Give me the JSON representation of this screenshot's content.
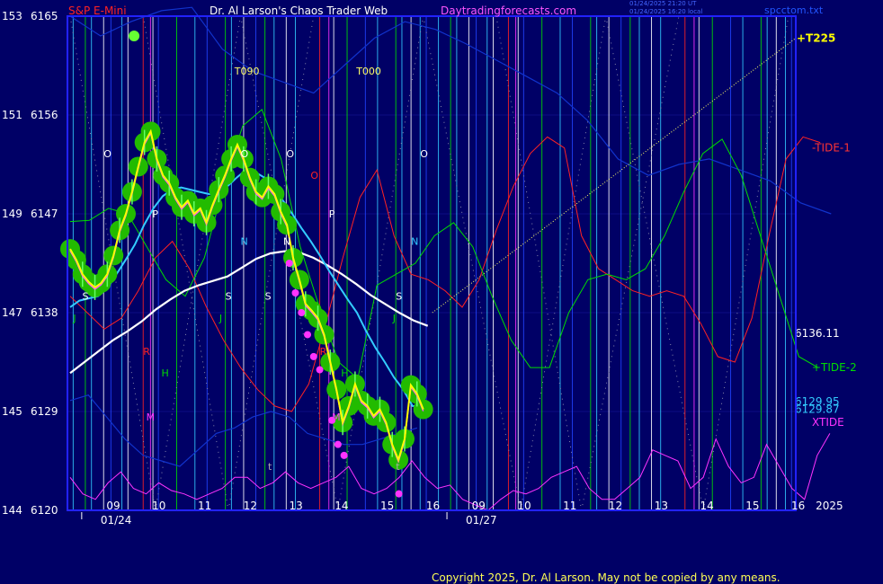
{
  "header": {
    "instrument": "S&P E-Mini",
    "author": "Dr. Al Larson's Chaos Trader Web",
    "site": "Daytradingforecasts.com",
    "timestamp_1": "01/24/2025 21:20 UT",
    "timestamp_2": "01/24/2025 16:20 local",
    "file": "spcctom.txt"
  },
  "footer": {
    "copyright": "Copyright 2025, Dr. Al Larson. May not be copied by any means."
  },
  "colors": {
    "background": "#000066",
    "plot_border": "#2222ff",
    "price_bead": "#22bb00",
    "price_line": "#ffff00",
    "tide1": "#ff2222",
    "tide2": "#00dd00",
    "xtide": "#ff33ff",
    "avg_fast": "#33ccff",
    "avg_slow": "#ffffff",
    "blue_band": "#1133cc",
    "trend": "#ffff66"
  },
  "chart_data": {
    "type": "line",
    "x_ticks": [
      {
        "label": "09",
        "i": 7
      },
      {
        "label": "10",
        "i": 14.5
      },
      {
        "label": "11",
        "i": 22
      },
      {
        "label": "12",
        "i": 29.5
      },
      {
        "label": "13",
        "i": 37
      },
      {
        "label": "14",
        "i": 44.5
      },
      {
        "label": "15",
        "i": 52
      },
      {
        "label": "16",
        "i": 59.5
      },
      {
        "label": "09",
        "i": 67
      },
      {
        "label": "10",
        "i": 74.5
      },
      {
        "label": "11",
        "i": 82
      },
      {
        "label": "12",
        "i": 89.5
      },
      {
        "label": "13",
        "i": 97
      },
      {
        "label": "14",
        "i": 104.5
      },
      {
        "label": "15",
        "i": 112
      },
      {
        "label": "16",
        "i": 119.5
      },
      {
        "label": "2025",
        "i": 123.5
      }
    ],
    "date_labels": [
      {
        "label": "01/24",
        "i": 5
      },
      {
        "label": "01/27",
        "i": 65
      }
    ],
    "y_ticks": [
      {
        "left": "153",
        "value": 6165
      },
      {
        "left": "151",
        "value": 6156
      },
      {
        "left": "149",
        "value": 6147
      },
      {
        "left": "147",
        "value": 6138
      },
      {
        "left": "145",
        "value": 6129
      },
      {
        "left": "144",
        "value": 6120
      }
    ],
    "ylim": [
      6120,
      6165
    ],
    "x_range": [
      0,
      120
    ],
    "series": [
      {
        "key": "price",
        "values": [
          6143.8,
          6142.8,
          6141.5,
          6140.8,
          6140.3,
          6140.7,
          6141.5,
          6143.2,
          6145.5,
          6147.0,
          6149.0,
          6151.3,
          6153.5,
          6154.5,
          6152.0,
          6150.5,
          6149.8,
          6148.5,
          6147.6,
          6148.2,
          6147.0,
          6147.5,
          6146.2,
          6147.8,
          6149.2,
          6150.5,
          6152.0,
          6153.3,
          6152.0,
          6150.3,
          6149.0,
          6148.5,
          6149.5,
          6148.8,
          6147.2,
          6146.0,
          6143.0,
          6141.0,
          6138.8,
          6138.2,
          6137.5,
          6136.0,
          6133.5,
          6131.0,
          6128.0,
          6129.5,
          6131.5,
          6130.0,
          6129.5,
          6128.6,
          6129.2,
          6128.0,
          6126.0,
          6124.6,
          6126.5,
          6131.4,
          6130.6,
          6129.2
        ]
      },
      {
        "key": "avg_fast",
        "values": [
          6138.5,
          6139.1,
          6139.3,
          6139.5,
          6140.2,
          6141.5,
          6142.8,
          6144.2,
          6146.0,
          6147.5,
          6148.6,
          6149.2,
          6149.4,
          6149.2,
          6149.0,
          6148.8,
          6148.9,
          6149.5,
          6150.3,
          6151.0,
          6150.8,
          6150.3,
          6149.5,
          6148.2,
          6147.0,
          6145.7,
          6144.5,
          6143.2,
          6141.8,
          6140.5,
          6139.2,
          6138.0,
          6136.3,
          6134.8,
          6133.5,
          6132.1,
          6131.0,
          6129.5,
          6129.5
        ]
      },
      {
        "key": "avg_slow",
        "values": [
          6132.5,
          6133.5,
          6134.5,
          6135.5,
          6136.3,
          6137.2,
          6138.3,
          6139.2,
          6140.0,
          6140.5,
          6140.9,
          6141.3,
          6142.1,
          6142.9,
          6143.4,
          6143.6,
          6143.5,
          6143.0,
          6142.3,
          6141.5,
          6140.6,
          6139.6,
          6138.8,
          6138.0,
          6137.3,
          6136.8
        ]
      },
      {
        "key": "tide1",
        "values": [
          6139.5,
          6138.0,
          6136.5,
          6137.5,
          6140.0,
          6143.0,
          6144.5,
          6142.0,
          6138.5,
          6135.5,
          6133.0,
          6131.0,
          6129.5,
          6129.0,
          6131.5,
          6137.0,
          6143.0,
          6148.5,
          6151.0,
          6145.0,
          6141.5,
          6141.0,
          6140.0,
          6138.5,
          6141.0,
          6145.5,
          6149.5,
          6152.5,
          6154.0,
          6153.0,
          6145.0,
          6142.0,
          6141.0,
          6140.0,
          6139.5,
          6140.0,
          6139.5,
          6137.0,
          6134.0,
          6133.5,
          6137.5,
          6145.0,
          6152.0,
          6154.0,
          6153.5
        ]
      },
      {
        "key": "tide2",
        "values": [
          6146.3,
          6146.4,
          6147.5,
          6147.0,
          6144.0,
          6141.0,
          6139.5,
          6143.0,
          6149.5,
          6155.0,
          6156.5,
          6152.0,
          6144.0,
          6138.5,
          6133.5,
          6132.0,
          6140.5,
          6141.5,
          6142.5,
          6145.0,
          6146.2,
          6144.0,
          6139.5,
          6135.5,
          6133.0,
          6133.0,
          6138.0,
          6141.0,
          6141.5,
          6141.0,
          6142.0,
          6145.0,
          6149.0,
          6152.5,
          6153.8,
          6150.5,
          6145.0,
          6139.5,
          6134.0,
          6133.0
        ]
      },
      {
        "key": "xtide",
        "values": [
          6123.0,
          6121.5,
          6121.0,
          6122.5,
          6123.5,
          6122.0,
          6121.5,
          6122.5,
          6121.8,
          6121.5,
          6121.0,
          6121.5,
          6122.0,
          6123.0,
          6123.0,
          6122.0,
          6122.5,
          6123.5,
          6122.5,
          6122.0,
          6122.5,
          6123.0,
          6124.0,
          6122.0,
          6121.5,
          6122.0,
          6123.0,
          6124.5,
          6123.0,
          6122.0,
          6122.3,
          6121.0,
          6120.5,
          6120.0,
          6121.0,
          6121.8,
          6121.5,
          6122.0,
          6123.0,
          6123.5,
          6124.0,
          6122.0,
          6121.0,
          6121.0,
          6122.0,
          6123.0,
          6125.5,
          6125.0,
          6124.5,
          6122.0,
          6123.0,
          6126.5,
          6124.0,
          6122.5,
          6123.0,
          6126.0,
          6124.0,
          6122.0,
          6121.0,
          6125.0,
          6127.0
        ]
      },
      {
        "key": "blue_top",
        "values": [
          6165.0,
          6163.2,
          6164.5,
          6165.5,
          6165.8,
          6162.0,
          6160.0,
          6159.0,
          6158.0,
          6160.5,
          6163.0,
          6164.5,
          6163.8,
          6162.5,
          6161.0,
          6159.5,
          6158.0,
          6155.5,
          6152.0,
          6150.5,
          6151.5,
          6152.0,
          6151.0,
          6150.0,
          6148.0,
          6147.0
        ]
      },
      {
        "key": "blue_bottom",
        "values": [
          6130.0,
          6130.5,
          6128.5,
          6126.5,
          6125.0,
          6124.5,
          6124.0,
          6125.5,
          6127.0,
          6127.5,
          6128.5,
          6129.0,
          6128.5,
          6127.0,
          6126.5,
          6126.0,
          6126.0,
          6126.5,
          6127.0,
          6127.5
        ]
      },
      {
        "key": "trend",
        "values": [
          6138.0,
          6163.0
        ]
      }
    ],
    "annotations": [
      {
        "text": "+T225",
        "value": 6163,
        "color": "#ffff00",
        "type": "right"
      },
      {
        "text": "-TIDE-1",
        "value": 6153,
        "color": "#ff3333",
        "type": "right"
      },
      {
        "text": "6136.11",
        "value": 6136.1,
        "color": "#ffffff",
        "type": "right"
      },
      {
        "text": "+TIDE-2",
        "value": 6133.0,
        "color": "#00dd00",
        "type": "right"
      },
      {
        "text": "6129.95",
        "value": 6129.9,
        "color": "#33ccff",
        "type": "right"
      },
      {
        "text": "6129.87",
        "value": 6129.2,
        "color": "#33ccff",
        "type": "right"
      },
      {
        "text": "XTIDE",
        "value": 6128.0,
        "color": "#ff33ff",
        "type": "right"
      },
      {
        "text": "T090",
        "i": 27,
        "value": 6160.0,
        "color": "#ffff66",
        "type": "plot"
      },
      {
        "text": "T000",
        "i": 47,
        "value": 6160.0,
        "color": "#ffff66",
        "type": "plot"
      },
      {
        "text": "O",
        "i": 5.5,
        "value": 6152.5,
        "color": "#ffffff",
        "type": "plot"
      },
      {
        "text": "O",
        "i": 28,
        "value": 6152.5,
        "color": "#ffffff",
        "type": "plot"
      },
      {
        "text": "O",
        "i": 35.5,
        "value": 6152.5,
        "color": "#ffffff",
        "type": "plot"
      },
      {
        "text": "O",
        "i": 39.5,
        "value": 6150.5,
        "color": "#ff2222",
        "type": "plot"
      },
      {
        "text": "O",
        "i": 57.5,
        "value": 6152.5,
        "color": "#ffffff",
        "type": "plot"
      },
      {
        "text": "P",
        "i": 13.5,
        "value": 6147.0,
        "color": "#ffffff",
        "type": "plot"
      },
      {
        "text": "P",
        "i": 42.5,
        "value": 6147.0,
        "color": "#ffffff",
        "type": "plot"
      },
      {
        "text": "N",
        "i": 28,
        "value": 6144.5,
        "color": "#33ccff",
        "type": "plot"
      },
      {
        "text": "N",
        "i": 35,
        "value": 6144.5,
        "color": "#ffffff",
        "type": "plot"
      },
      {
        "text": "N",
        "i": 56,
        "value": 6144.5,
        "color": "#33ccff",
        "type": "plot"
      },
      {
        "text": "S",
        "i": 2,
        "value": 6139.5,
        "color": "#ffffff",
        "type": "plot"
      },
      {
        "text": "S",
        "i": 25.5,
        "value": 6139.5,
        "color": "#ffffff",
        "type": "plot"
      },
      {
        "text": "S",
        "i": 32,
        "value": 6139.5,
        "color": "#ffffff",
        "type": "plot"
      },
      {
        "text": "S",
        "i": 53.5,
        "value": 6139.5,
        "color": "#ffffff",
        "type": "plot"
      },
      {
        "text": "J",
        "i": 0.5,
        "value": 6137.5,
        "color": "#00dd00",
        "type": "plot"
      },
      {
        "text": "J",
        "i": 24.5,
        "value": 6137.5,
        "color": "#00dd00",
        "type": "plot"
      },
      {
        "text": "J",
        "i": 53,
        "value": 6137.5,
        "color": "#00dd00",
        "type": "plot"
      },
      {
        "text": "R",
        "i": 12,
        "value": 6134.5,
        "color": "#ff2222",
        "type": "plot"
      },
      {
        "text": "R",
        "i": 41,
        "value": 6134.5,
        "color": "#ff2222",
        "type": "plot"
      },
      {
        "text": "H",
        "i": 15,
        "value": 6132.5,
        "color": "#00dd00",
        "type": "plot"
      },
      {
        "text": "H",
        "i": 44.5,
        "value": 6132.5,
        "color": "#00dd00",
        "type": "plot"
      },
      {
        "text": "M",
        "i": 12.5,
        "value": 6128.5,
        "color": "#ff33ff",
        "type": "plot"
      },
      {
        "text": "M",
        "i": 43,
        "value": 6128.5,
        "color": "#ff33ff",
        "type": "plot"
      },
      {
        "text": "t",
        "i": 32.5,
        "value": 6124.0,
        "color": "#aaaaaa",
        "type": "plot"
      },
      {
        "text": "t",
        "i": 53.5,
        "value": 6124.0,
        "color": "#aaaaaa",
        "type": "plot"
      }
    ],
    "vlines": [
      {
        "i": 0.5,
        "color": "#33ccff"
      },
      {
        "i": 2.5,
        "color": "#00dd00"
      },
      {
        "i": 3.5,
        "color": "#33ccff"
      },
      {
        "i": 5.5,
        "color": "#ffffff"
      },
      {
        "i": 6.7,
        "color": "#2244ff"
      },
      {
        "i": 8.5,
        "color": "#33ccff"
      },
      {
        "i": 9.5,
        "color": "#ffffff"
      },
      {
        "i": 12,
        "color": "#ff2222"
      },
      {
        "i": 13.2,
        "color": "#ff33ff"
      },
      {
        "i": 13.6,
        "color": "#ffffff"
      },
      {
        "i": 14.5,
        "color": "#2244ff"
      },
      {
        "i": 17.5,
        "color": "#00dd00"
      },
      {
        "i": 20.5,
        "color": "#33ccff"
      },
      {
        "i": 22.5,
        "color": "#2244ff"
      },
      {
        "i": 25.5,
        "color": "#00dd00"
      },
      {
        "i": 26.5,
        "color": "#33ccff"
      },
      {
        "i": 28.5,
        "color": "#ffffff"
      },
      {
        "i": 30.5,
        "color": "#2244ff"
      },
      {
        "i": 32,
        "color": "#00dd00"
      },
      {
        "i": 33.5,
        "color": "#33ccff"
      },
      {
        "i": 35.5,
        "color": "#ffffff"
      },
      {
        "i": 37,
        "color": "#33ccff"
      },
      {
        "i": 41,
        "color": "#ff2222"
      },
      {
        "i": 42.5,
        "color": "#ff33ff"
      },
      {
        "i": 43.3,
        "color": "#ffffff"
      },
      {
        "i": 45.5,
        "color": "#00dd00"
      },
      {
        "i": 48.5,
        "color": "#2244ff"
      },
      {
        "i": 50.5,
        "color": "#33ccff"
      },
      {
        "i": 53.5,
        "color": "#00dd00"
      },
      {
        "i": 54.5,
        "color": "#33ccff"
      },
      {
        "i": 56,
        "color": "#ffffff"
      },
      {
        "i": 57.5,
        "color": "#33ccff"
      },
      {
        "i": 58.5,
        "color": "#2244ff"
      }
    ]
  }
}
